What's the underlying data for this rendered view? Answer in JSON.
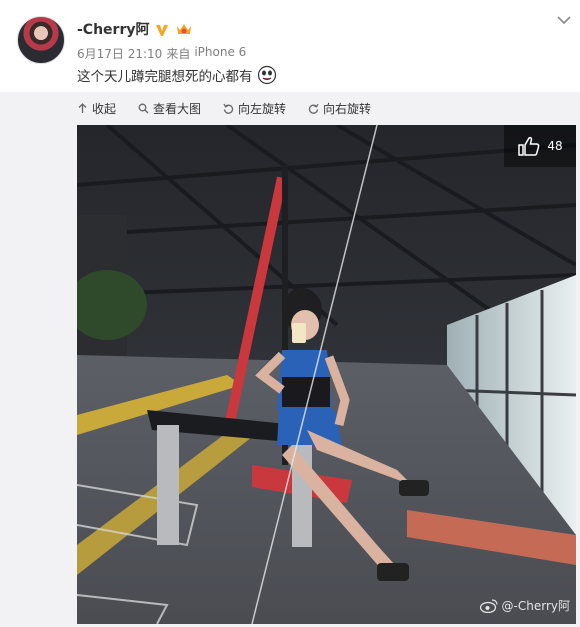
{
  "post": {
    "username": "-Cherry阿",
    "date": "6月17日 21:10",
    "source_prefix": "来自",
    "source": "iPhone 6",
    "text": "这个天儿蹲完腿想死的心都有"
  },
  "toolbar": {
    "collapse_label": "收起",
    "view_large_label": "查看大图",
    "rotate_left_label": "向左旋转",
    "rotate_right_label": "向右旋转"
  },
  "photo": {
    "like_count": "48",
    "watermark": "@-Cherry阿"
  },
  "icons": [
    "verified-icon",
    "vip-crown-icon",
    "emoji-icon",
    "chevron-down-icon",
    "collapse-icon",
    "magnifier-icon",
    "rotate-left-icon",
    "rotate-right-icon",
    "thumbs-up-icon",
    "weibo-logo-icon"
  ],
  "colors": {
    "verified": "#f6a623",
    "link_gray": "#808080",
    "panel_bg": "#f2f2f5"
  }
}
